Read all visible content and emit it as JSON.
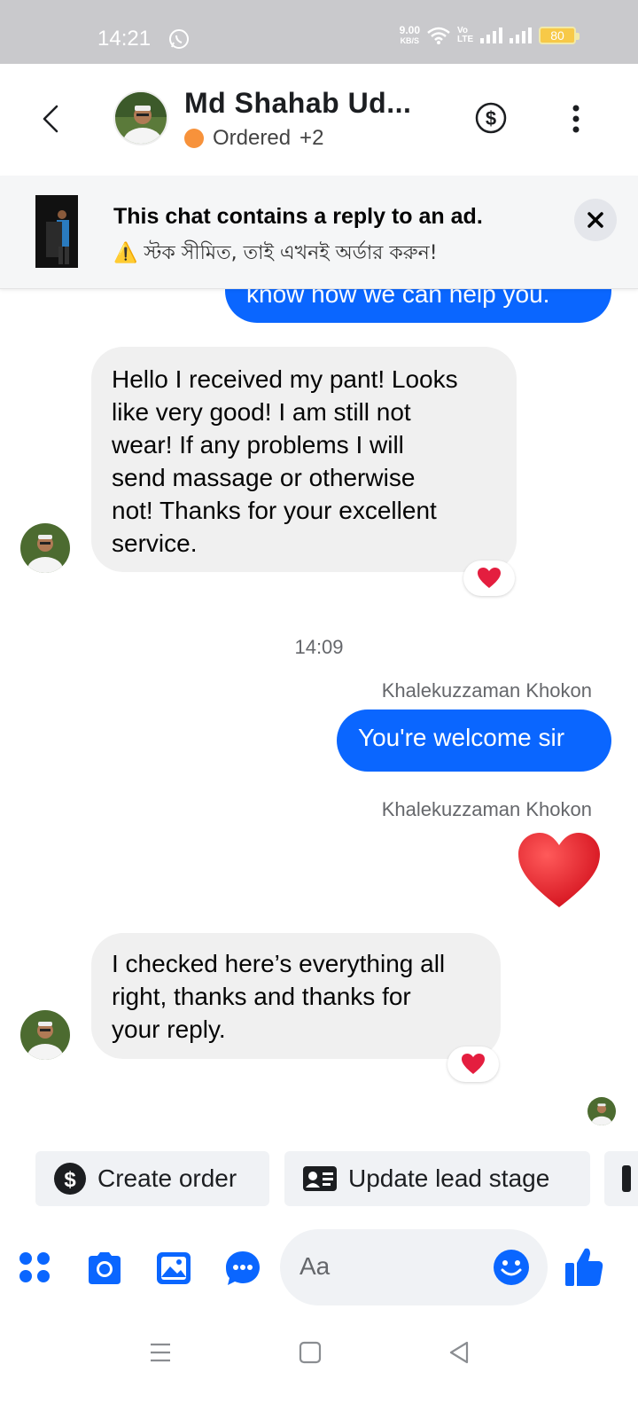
{
  "status_bar": {
    "time": "14:21",
    "net_speed_value": "9.00",
    "net_speed_unit": "KB/S",
    "battery": "80",
    "volte": "Vo LTE"
  },
  "header": {
    "contact_name": "Md Shahab Ud...",
    "status_label": "Ordered",
    "status_extra": "+2",
    "status_color": "#f7923b"
  },
  "ad_banner": {
    "title": "This chat contains a reply to an ad.",
    "subtitle": "⚠️ স্টক সীমিত, তাই এখনই অর্ডার করুন!"
  },
  "messages": [
    {
      "type": "outgoing_partial",
      "text": "know how we can help you."
    },
    {
      "type": "incoming",
      "lines": [
        "Hello I received my pant! Looks",
        "like very good! I am still not",
        "wear! If any problems I will",
        "send massage or otherwise",
        "not! Thanks for your excellent",
        "service."
      ],
      "reaction": "heart"
    },
    {
      "type": "timestamp",
      "text": "14:09"
    },
    {
      "type": "sender",
      "text": "Khalekuzzaman Khokon"
    },
    {
      "type": "outgoing",
      "text": "You're welcome sir"
    },
    {
      "type": "sender",
      "text": "Khalekuzzaman Khokon"
    },
    {
      "type": "outgoing_emoji",
      "emoji": "heart"
    },
    {
      "type": "incoming",
      "lines": [
        "I checked here’s everything all",
        "right, thanks and thanks for",
        "your reply."
      ],
      "reaction": "heart"
    }
  ],
  "quick_actions": [
    {
      "label": "Create order",
      "icon": "dollar-circle-icon"
    },
    {
      "label": "Update lead stage",
      "icon": "contact-card-icon"
    }
  ],
  "composer": {
    "placeholder": "Aa",
    "icons": [
      "apps-icon",
      "camera-icon",
      "gallery-icon",
      "chat-bubble-icon",
      "emoji-icon",
      "thumbs-up-icon"
    ]
  },
  "colors": {
    "accent": "#0a66ff",
    "incoming_bubble": "#f0f0f0",
    "heart": "#e41e3f"
  }
}
